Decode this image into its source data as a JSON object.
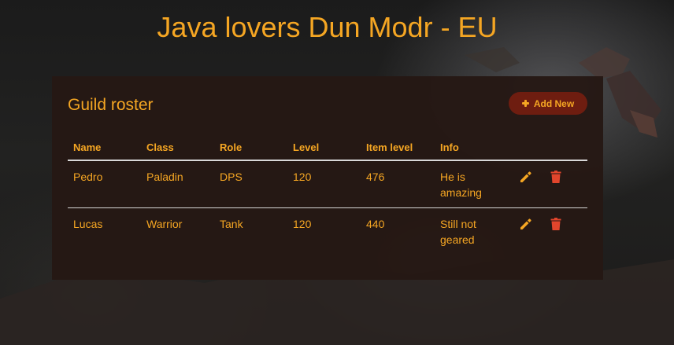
{
  "page": {
    "title": "Java lovers Dun Modr - EU"
  },
  "roster": {
    "title": "Guild roster",
    "add_button_label": "Add New",
    "columns": [
      "Name",
      "Class",
      "Role",
      "Level",
      "Item level",
      "Info"
    ],
    "rows": [
      {
        "name": "Pedro",
        "class": "Paladin",
        "role": "DPS",
        "level": "120",
        "item_level": "476",
        "info": "He is amazing"
      },
      {
        "name": "Lucas",
        "class": "Warrior",
        "role": "Tank",
        "level": "120",
        "item_level": "440",
        "info": "Still not geared"
      }
    ]
  },
  "icons": {
    "add": "plus-icon",
    "edit": "pencil-icon",
    "delete": "trash-icon"
  },
  "colors": {
    "accent": "#f5a623",
    "delete": "#e2452c",
    "button_bg": "#6e1d10",
    "panel_bg": "#251814"
  }
}
